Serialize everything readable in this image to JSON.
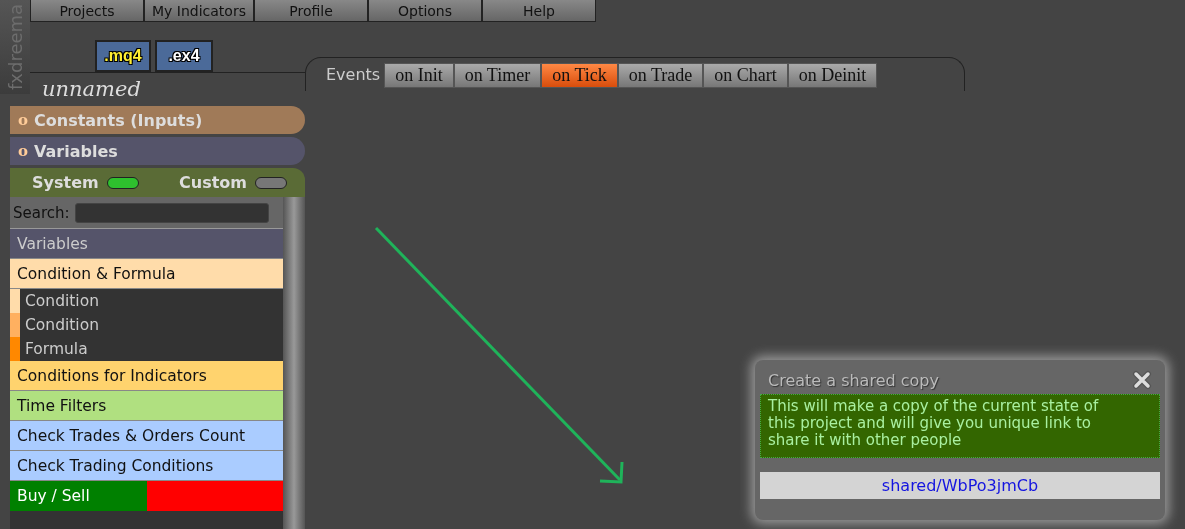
{
  "brand": "fxdreema",
  "menu": [
    {
      "label": "Projects"
    },
    {
      "label": "My Indicators"
    },
    {
      "label": "Profile"
    },
    {
      "label": "Options"
    },
    {
      "label": "Help"
    }
  ],
  "export_buttons": [
    {
      "label": ".mq4",
      "kind": "source"
    },
    {
      "label": ".ex4",
      "kind": "compiled"
    }
  ],
  "project_name": "unnamed",
  "sections": [
    {
      "marker": "o",
      "label": "Constants (Inputs)",
      "color": "#a07a58"
    },
    {
      "marker": "o",
      "label": "Variables",
      "color": "#55546a"
    }
  ],
  "filters": [
    {
      "label": "System",
      "on": true
    },
    {
      "label": "Custom",
      "on": false
    }
  ],
  "search": {
    "label": "Search:"
  },
  "blocks": [
    {
      "label": "Variables",
      "color": "#55546a"
    },
    {
      "label": "Condition & Formula",
      "color": "#ffdcaa",
      "children": [
        {
          "label": "Condition",
          "color": "#ffdcaa"
        },
        {
          "label": "Condition",
          "color": "#ffb060"
        },
        {
          "label": "Formula",
          "color": "#ff8800"
        }
      ]
    },
    {
      "label": "Conditions for Indicators",
      "color": "#ffd36e"
    },
    {
      "label": "Time Filters",
      "color": "#b0e080"
    },
    {
      "label": "Check Trades & Orders Count",
      "color": "#aaccff"
    },
    {
      "label": "Check Trading Conditions",
      "color": "#aaccff"
    },
    {
      "label": "Buy / Sell",
      "parts": [
        {
          "color": "#008000"
        },
        {
          "color": "#ff0000"
        }
      ]
    }
  ],
  "events": {
    "label": "Events",
    "tabs": [
      {
        "label": "on Init",
        "selected": false
      },
      {
        "label": "on Timer",
        "selected": false
      },
      {
        "label": "on Tick",
        "selected": true
      },
      {
        "label": "on Trade",
        "selected": false
      },
      {
        "label": "on Chart",
        "selected": false
      },
      {
        "label": "on Deinit",
        "selected": false
      }
    ]
  },
  "dialog": {
    "title": "Create a shared copy",
    "message": "This will make a copy of the current state of this project and will give you unique link to share it with other people",
    "link": "shared/WbPo3jmCb"
  }
}
